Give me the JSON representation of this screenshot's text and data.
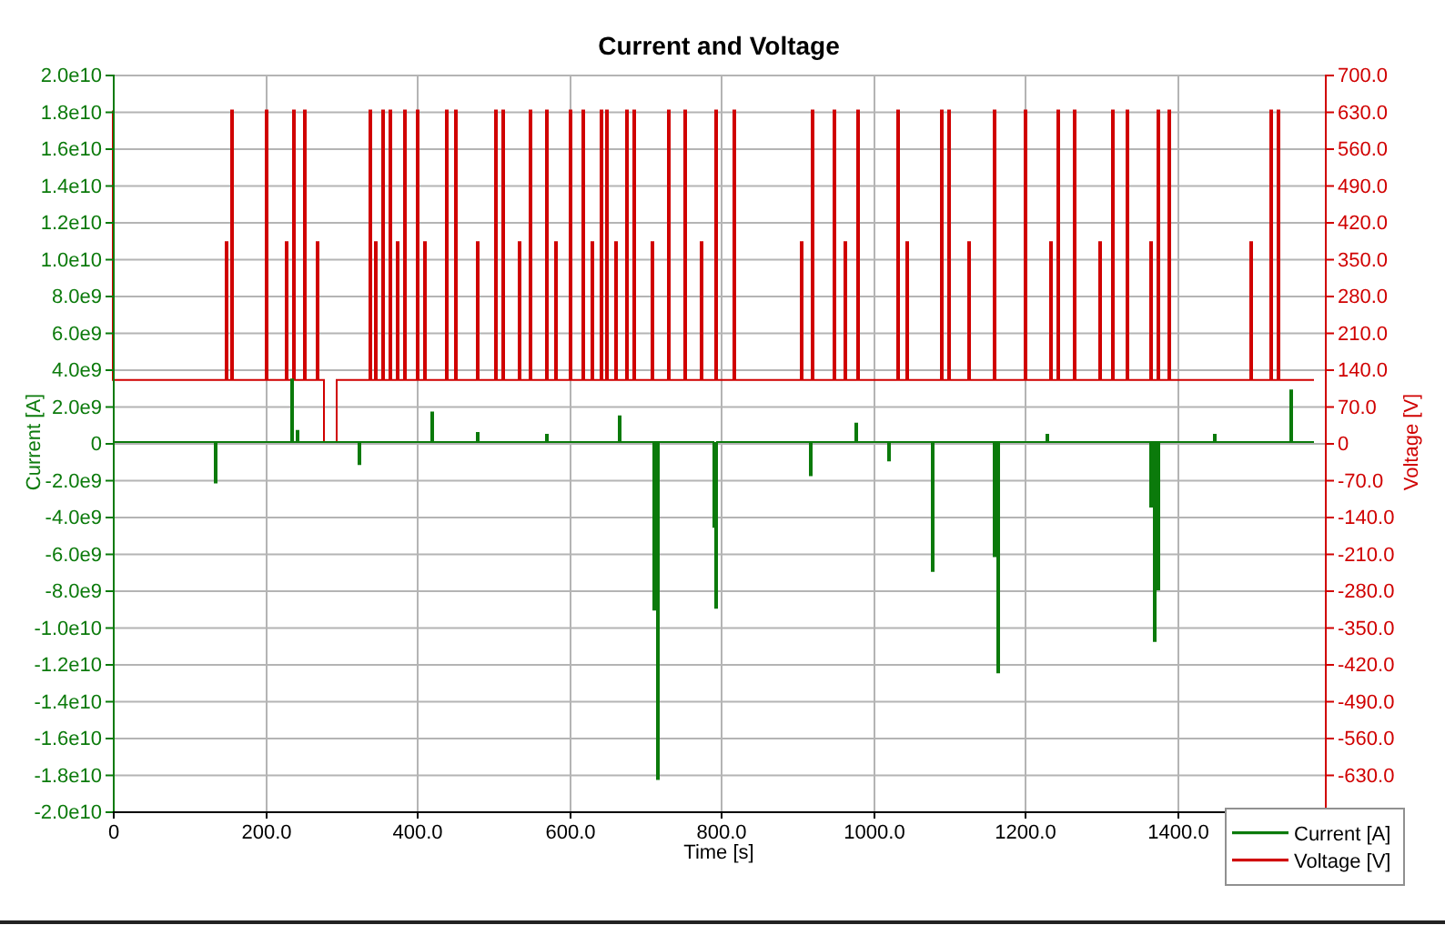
{
  "title": "Current and Voltage",
  "y_left": {
    "label": "Current [A]",
    "ticks": [
      "2.0e10",
      "1.8e10",
      "1.6e10",
      "1.4e10",
      "1.2e10",
      "1.0e10",
      "8.0e9",
      "6.0e9",
      "4.0e9",
      "2.0e9",
      "0",
      "-2.0e9",
      "-4.0e9",
      "-6.0e9",
      "-8.0e9",
      "-1.0e10",
      "-1.2e10",
      "-1.4e10",
      "-1.6e10",
      "-1.8e10",
      "-2.0e10"
    ]
  },
  "y_right": {
    "label": "Voltage [V]",
    "ticks": [
      "700.0",
      "630.0",
      "560.0",
      "490.0",
      "420.0",
      "350.0",
      "280.0",
      "210.0",
      "140.0",
      "70.0",
      "0",
      "-70.0",
      "-140.0",
      "-210.0",
      "-280.0",
      "-350.0",
      "-420.0",
      "-490.0",
      "-560.0",
      "-630.0"
    ]
  },
  "x_axis": {
    "label": "Time [s]",
    "ticks": [
      "0",
      "200.0",
      "400.0",
      "600.0",
      "800.0",
      "1000.0",
      "1200.0",
      "1400.0"
    ]
  },
  "legend": [
    {
      "label": "Current [A]",
      "color": "#0b7a0b"
    },
    {
      "label": "Voltage [V]",
      "color": "#d00000"
    }
  ]
}
